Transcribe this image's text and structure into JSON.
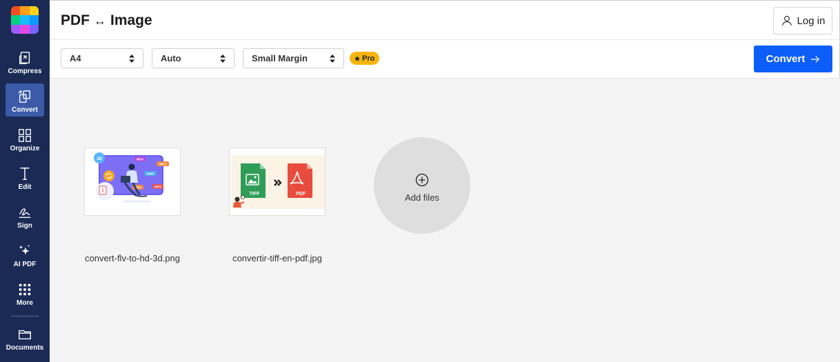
{
  "app": {
    "title_left": "PDF",
    "title_arrow": "↔",
    "title_right": "Image",
    "logo_colors": [
      "#f24e1e",
      "#ff9e1b",
      "#0acf83",
      "#1abcfe",
      "#0d99ff",
      "#a259ff",
      "#ff7262",
      "#e347e3",
      "#7b61ff"
    ]
  },
  "sidebar": {
    "items": [
      {
        "label": "Compress",
        "icon": "compress-icon"
      },
      {
        "label": "Convert",
        "icon": "convert-icon",
        "active": true
      },
      {
        "label": "Organize",
        "icon": "organize-icon"
      },
      {
        "label": "Edit",
        "icon": "edit-icon"
      },
      {
        "label": "Sign",
        "icon": "sign-icon"
      },
      {
        "label": "AI PDF",
        "icon": "sparkle-icon"
      },
      {
        "label": "More",
        "icon": "grid-icon"
      },
      {
        "label": "Documents",
        "icon": "folder-icon"
      }
    ]
  },
  "header": {
    "login_label": "Log in"
  },
  "toolbar": {
    "page_size": "A4",
    "orientation": "Auto",
    "margin": "Small Margin",
    "pro_label": "Pro",
    "convert_label": "Convert"
  },
  "files": [
    {
      "name": "convert-flv-to-hd-3d.png",
      "thumb_labels": [
        "3D",
        "MOV",
        "MKV",
        "WMV",
        "MP4",
        "MP3"
      ]
    },
    {
      "name": "convertir-tiff-en-pdf.jpg",
      "thumb_labels": [
        "TIFF",
        "PDF"
      ]
    }
  ],
  "add_files_label": "Add files",
  "colors": {
    "sidebar_bg": "#1b2a55",
    "sidebar_active": "#3b5ba8",
    "accent": "#0d5ef8",
    "pro_badge": "#f6b40e"
  }
}
